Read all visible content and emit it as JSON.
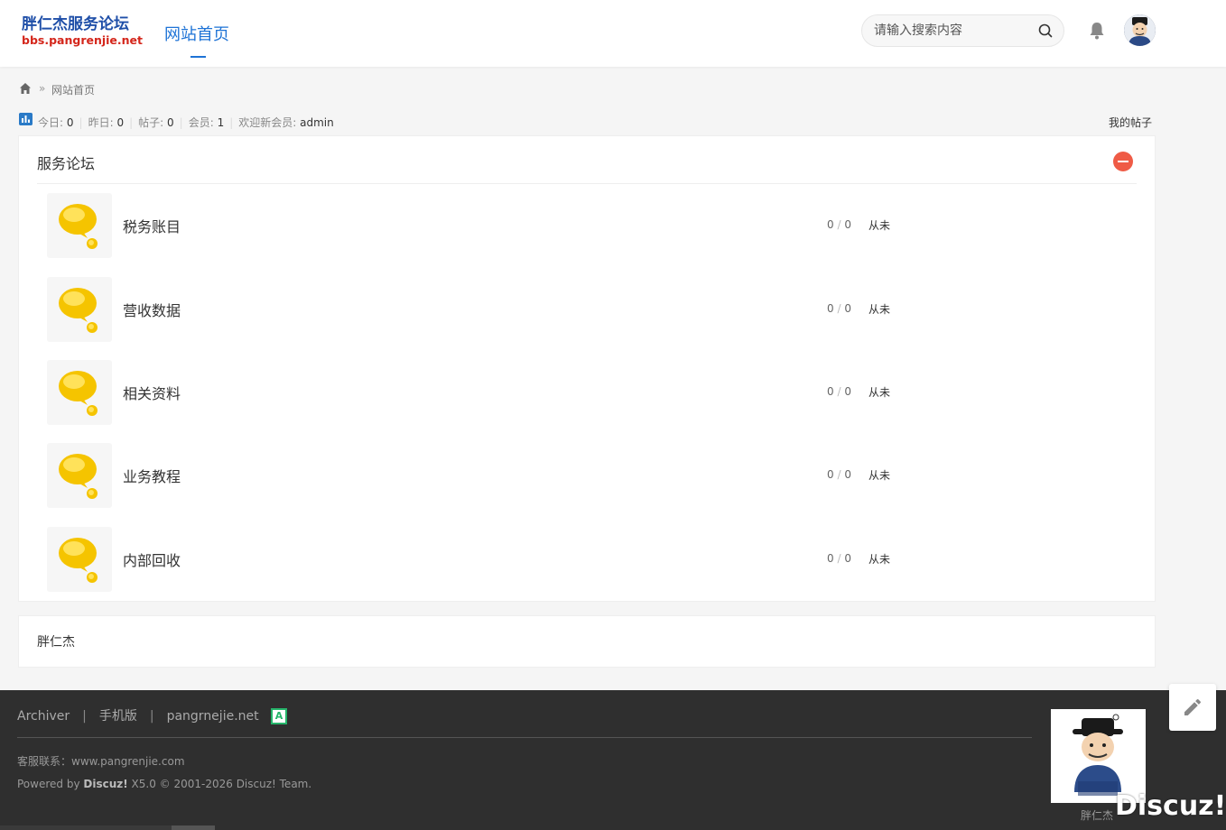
{
  "header": {
    "logo_line1": "胖仁杰服务论坛",
    "logo_line2": "bbs.pangrenjie.net",
    "nav_home": "网站首页",
    "search_placeholder": "请输入搜索内容",
    "icons": {
      "search": "search-icon",
      "notification": "bell-icon",
      "user": "avatar"
    }
  },
  "breadcrumb": {
    "separator": "»",
    "current": "网站首页"
  },
  "stats": {
    "today_label": "今日:",
    "today_value": "0",
    "yesterday_label": "昨日:",
    "yesterday_value": "0",
    "posts_label": "帖子:",
    "posts_value": "0",
    "members_label": "会员:",
    "members_value": "1",
    "newest_label": "欢迎新会员:",
    "newest_value": "admin",
    "my_posts": "我的帖子"
  },
  "forum_group": {
    "title": "服务论坛",
    "forums": [
      {
        "name": "税务账目",
        "threads": "0",
        "posts": "0",
        "last": "从未"
      },
      {
        "name": "营收数据",
        "threads": "0",
        "posts": "0",
        "last": "从未"
      },
      {
        "name": "相关资料",
        "threads": "0",
        "posts": "0",
        "last": "从未"
      },
      {
        "name": "业务教程",
        "threads": "0",
        "posts": "0",
        "last": "从未"
      },
      {
        "name": "内部回收",
        "threads": "0",
        "posts": "0",
        "last": "从未"
      }
    ]
  },
  "links": {
    "text": "胖仁杰"
  },
  "footer": {
    "archiver": "Archiver",
    "mobile": "手机版",
    "site": "pangrnejie.net",
    "badge": "A",
    "contact": "客服联系：www.pangrenjie.com",
    "powered_prefix": "Powered by ",
    "powered_brand": "Discuz!",
    "powered_suffix": " X5.0 © 2001-2026 Discuz! Team.",
    "qr_caption": "胖仁杰",
    "watermark": "Discuz!"
  },
  "colors": {
    "accent": "#1e73d6",
    "danger": "#ef5b46",
    "footer_bg": "#2f2f2f"
  }
}
